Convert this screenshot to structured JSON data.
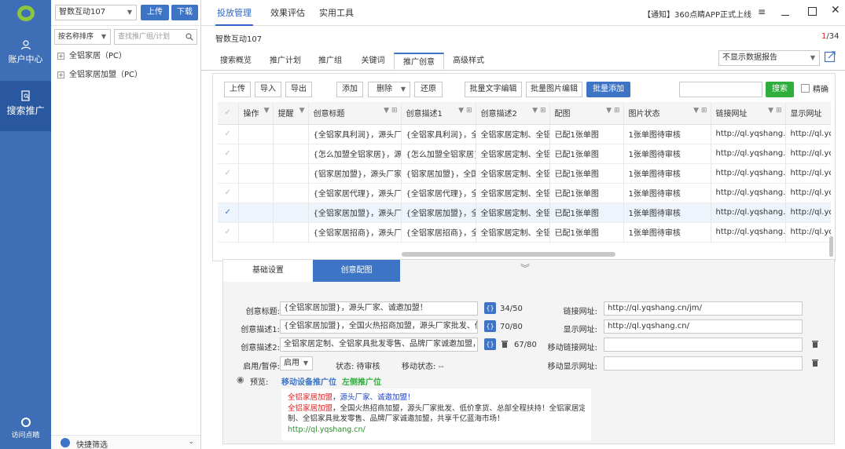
{
  "nav": {
    "account": "账户中心",
    "search": "搜索推广",
    "visit": "访问点睛"
  },
  "project": {
    "account_name": "智数互动107",
    "upload": "上传",
    "download": "下载",
    "sort_label": "按名称排序",
    "search_placeholder": "查找推广组/计划",
    "plans": [
      "全铝家居（PC）",
      "全铝家居加盟（PC）"
    ],
    "quick_filter": "快捷筛选"
  },
  "topbar": {
    "tabs": [
      "投放管理",
      "效果评估",
      "实用工具"
    ],
    "notice": "【通知】360点睛APP正式上线"
  },
  "main": {
    "breadcrumb": "智数互动107",
    "page_current": "1",
    "page_total": "/34",
    "tabs": [
      "搜索概览",
      "推广计划",
      "推广组",
      "关键词",
      "推广创意",
      "高级样式"
    ],
    "report_select": "不显示数据报告",
    "toolbar": {
      "upload": "上传",
      "import": "导入",
      "export": "导出",
      "add": "添加",
      "delete": "删除",
      "restore": "还原",
      "batch_text": "批量文字编辑",
      "batch_image": "批量图片编辑",
      "batch_add": "批量添加",
      "search": "搜索",
      "exact": "精确"
    },
    "table": {
      "headers": [
        "操作",
        "提醒",
        "创意标题",
        "创意描述1",
        "创意描述2",
        "配图",
        "图片状态",
        "链接网址",
        "显示网址"
      ],
      "rows": [
        {
          "title": "{全铝家具利润}，源头厂家",
          "desc1": "{全铝家具利润}，全国",
          "desc2": "全铝家居定制、全铝",
          "image": "已配1张单图",
          "status": "1张单图待审核",
          "url": "http://ql.yqshang.c",
          "display": "http://ql.yqs"
        },
        {
          "title": "{怎么加盟全铝家居}，源头",
          "desc1": "{怎么加盟全铝家居}，",
          "desc2": "全铝家居定制、全铝",
          "image": "已配1张单图",
          "status": "1张单图待审核",
          "url": "http://ql.yqshang.c",
          "display": "http://ql.yqs"
        },
        {
          "title": "{铝家居加盟}，源头厂家、",
          "desc1": "{铝家居加盟}，全国火",
          "desc2": "全铝家居定制、全铝",
          "image": "已配1张单图",
          "status": "1张单图待审核",
          "url": "http://ql.yqshang.c",
          "display": "http://ql.yqs"
        },
        {
          "title": "{全铝家居代理}，源头厂家",
          "desc1": "{全铝家居代理}，全铝",
          "desc2": "全铝家居定制、全铝",
          "image": "已配1张单图",
          "status": "1张单图待审核",
          "url": "http://ql.yqshang.c",
          "display": "http://ql.yqs"
        },
        {
          "title": "{全铝家居加盟}，源头厂家",
          "desc1": "{全铝家居加盟}，全铝",
          "desc2": "全铝家居定制、全铝",
          "image": "已配1张单图",
          "status": "1张单图待审核",
          "url": "http://ql.yqshang.c",
          "display": "http://ql.yqs"
        },
        {
          "title": "{全铝家居招商}，源头厂家",
          "desc1": "{全铝家居招商}，全铝",
          "desc2": "全铝家居定制、全铝",
          "image": "已配1张单图",
          "status": "1张单图待审核",
          "url": "http://ql.yqshang.c",
          "display": "http://ql.yqs"
        }
      ]
    }
  },
  "editor": {
    "tab_basic": "基础设置",
    "tab_image": "创意配图",
    "title_label": "创意标题:",
    "title_value": "{全铝家居加盟}，源头厂家、诚邀加盟！",
    "title_count": "34/50",
    "desc1_label": "创意描述1:",
    "desc1_value": "{全铝家居加盟}，全国火热招商加盟，源头厂家批发、低价拿",
    "desc1_count": "70/80",
    "desc2_label": "创意描述2:",
    "desc2_value": "全铝家居定制、全铝家具批发零售、品牌厂家诚邀加盟，共享",
    "desc2_count": "67/80",
    "enable_label": "启用/暂停:",
    "enable_value": "启用",
    "status_label": "状态: 待审核",
    "mobile_status": "移动状态: --",
    "link_label": "链接网址:",
    "link_value": "http://ql.yqshang.cn/jm/",
    "display_label": "显示网址:",
    "display_value": "http://ql.yqshang.cn/",
    "mlink_label": "移动链接网址:",
    "mdisplay_label": "移动显示网址:",
    "preview_label": "预览:",
    "preview_mobile": "移动设备推广位",
    "preview_left": "左侧推广位",
    "preview": {
      "line1_a": "全铝家居加盟",
      "line1_b": "，源头厂家、诚邀加盟！",
      "line2_a": "全铝家居加盟",
      "line2_b": "，全国火热招商加盟，源头厂家批发、低价拿货、总部全程扶持！全铝家居定",
      "line3": "制、全铝家具批发零售、品牌厂家诚邀加盟，共享千亿蓝海市场！",
      "url": "http://ql.yqshang.cn/"
    }
  },
  "colors": {
    "nav": "#3e6eb5",
    "accent": "#3d74c6",
    "search_btn": "#2fae3c",
    "preview_red": "#e02020",
    "preview_blue": "#1a3fd0",
    "preview_green": "#2e8b2e"
  }
}
